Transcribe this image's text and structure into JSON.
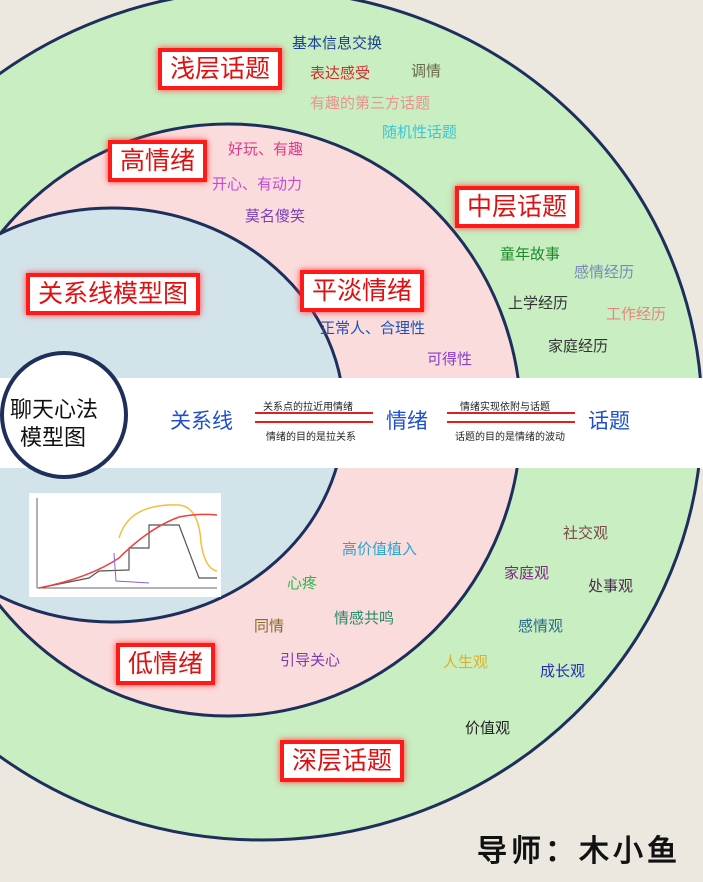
{
  "center": {
    "line1": "聊天心法",
    "line2": "模型图"
  },
  "labels": {
    "shallow": "浅层话题",
    "middle": "中层话题",
    "deep": "深层话题",
    "high": "高情绪",
    "calm": "平淡情绪",
    "low": "低情绪",
    "relation_model": "关系线模型图"
  },
  "shallow_items": [
    "基本信息交换",
    "表达感受",
    "调情",
    "有趣的第三方话题",
    "随机性话题"
  ],
  "high_items": [
    "好玩、有趣",
    "开心、有动力",
    "莫名傻笑"
  ],
  "calm_items": [
    "正常人、合理性",
    "可得性"
  ],
  "middle_items": [
    "童年故事",
    "感情经历",
    "上学经历",
    "工作经历",
    "家庭经历"
  ],
  "low_items": [
    "高价值植入",
    "心疼",
    "同情",
    "情感共鸣",
    "引导关心"
  ],
  "deep_items": [
    "社交观",
    "家庭观",
    "处事观",
    "感情观",
    "人生观",
    "成长观",
    "价值观"
  ],
  "flow": {
    "a": "关系线",
    "b": "情绪",
    "c": "话题",
    "ab_top": "关系点的拉近用情绪",
    "ab_bottom": "情绪的目的是拉关系",
    "bc_top": "情绪实现依附与话题",
    "bc_bottom": "话题的目的是情绪的波动"
  },
  "signature": "导师：木小鱼",
  "colors": {
    "outer": "#c8eec2",
    "middle": "#fadcdc",
    "inner": "#d3e3ea",
    "ring": "#1d2f5a",
    "box": "#ff1a1a",
    "flow": "#1f4fd0"
  }
}
